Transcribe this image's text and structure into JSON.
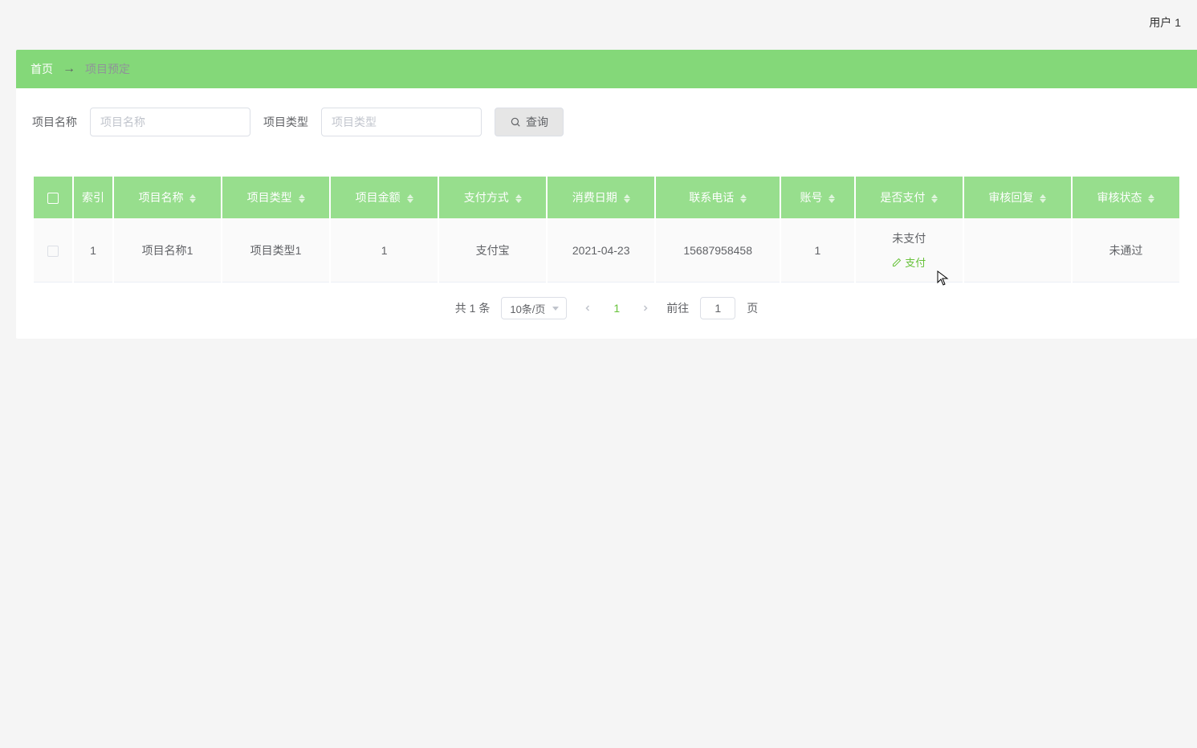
{
  "header": {
    "user": "用户 1"
  },
  "breadcrumb": {
    "home": "首页",
    "current": "项目预定"
  },
  "search": {
    "name_label": "项目名称",
    "name_placeholder": "项目名称",
    "type_label": "项目类型",
    "type_placeholder": "项目类型",
    "query_btn": "查询"
  },
  "table": {
    "columns": [
      "索引",
      "项目名称",
      "项目类型",
      "项目金额",
      "支付方式",
      "消费日期",
      "联系电话",
      "账号",
      "是否支付",
      "审核回复",
      "审核状态"
    ],
    "rows": [
      {
        "index": "1",
        "name": "项目名称1",
        "type": "项目类型1",
        "amount": "1",
        "pay_method": "支付宝",
        "date": "2021-04-23",
        "phone": "15687958458",
        "account": "1",
        "pay_status": "未支付",
        "pay_action": "支付",
        "reply": "",
        "review_status": "未通过"
      }
    ]
  },
  "pagination": {
    "total_text": "共 1 条",
    "page_size": "10条/页",
    "current_page": "1",
    "jump_prefix": "前往",
    "jump_value": "1",
    "jump_suffix": "页"
  }
}
